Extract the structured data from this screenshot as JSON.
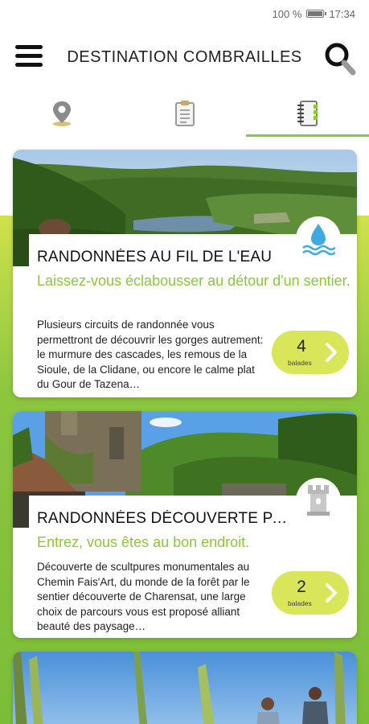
{
  "status_bar": {
    "battery_text": "100 %",
    "time": "17:34"
  },
  "app_bar": {
    "title": "DESTINATION COMBRAILLES"
  },
  "tabs": [
    {
      "icon": "map-pin-icon",
      "active": false
    },
    {
      "icon": "checklist-icon",
      "active": false
    },
    {
      "icon": "notebook-icon",
      "active": true
    }
  ],
  "cards": [
    {
      "title": "RANDONNÉES AU FIL DE L'EAU",
      "subtitle": "Laissez-vous éclabousser au détour d'un sentier.",
      "description": "Plusieurs circuits de randonnée vous permettront de découvrir les gorges autrement: le murmure des cascades, les remous de la Sioule, de la Clidane, ou encore le calme plat du Gour de Tazena…",
      "count": "4",
      "count_unit": "balades",
      "badge_icon": "water-drop-icon"
    },
    {
      "title": "RANDONNÉES DÉCOUVERTE PAT…",
      "subtitle": "Entrez, vous êtes au bon endroit.",
      "description": "Découverte de scultpures monumentales au Chemin Fais'Art, du monde de la forêt par le sentier découverte de Charensat, une large choix de parcours vous est proposé alliant beauté des paysage…",
      "count": "2",
      "count_unit": "balades",
      "badge_icon": "tower-icon"
    }
  ],
  "colors": {
    "accent_green": "#8cc63f",
    "pill_yellow": "#d9e65a"
  }
}
